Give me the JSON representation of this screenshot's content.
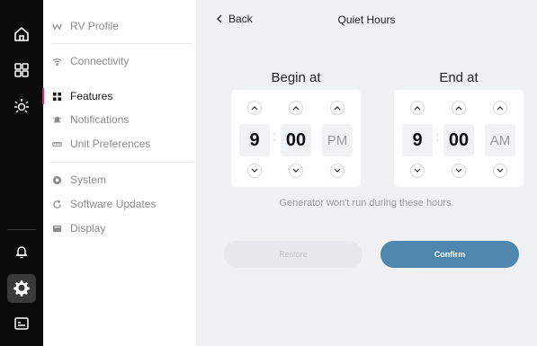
{
  "rail": {
    "items": [
      {
        "icon": "home-icon"
      },
      {
        "icon": "grid-icon"
      },
      {
        "icon": "brightness-icon"
      },
      {
        "icon": "bell-icon"
      },
      {
        "icon": "gear-icon"
      },
      {
        "icon": "device-icon"
      }
    ],
    "active": "gear-icon"
  },
  "menu": {
    "items": [
      {
        "label": "RV Profile",
        "icon": "rv-icon"
      },
      {
        "label": "Connectivity",
        "icon": "wifi-icon"
      },
      {
        "label": "Features",
        "icon": "features-icon"
      },
      {
        "label": "Notifications",
        "icon": "notification-icon"
      },
      {
        "label": "Unit Preferences",
        "icon": "ruler-icon"
      },
      {
        "label": "System",
        "icon": "system-icon"
      },
      {
        "label": "Software Updates",
        "icon": "refresh-icon"
      },
      {
        "label": "Display",
        "icon": "display-icon"
      }
    ],
    "active": "Features"
  },
  "header": {
    "back_label": "Back",
    "title": "Quiet Hours"
  },
  "begin": {
    "label": "Begin at",
    "hour": "9",
    "minute": "00",
    "period": "PM"
  },
  "end": {
    "label": "End at",
    "hour": "9",
    "minute": "00",
    "period": "AM"
  },
  "colon": ":",
  "hint": "Generator won't run during these hours.",
  "buttons": {
    "restore": "Restore",
    "confirm": "Confirm"
  },
  "colors": {
    "accent": "#4f86ad",
    "active_marker": "#e0245e",
    "rail_bg": "#0b0b0b",
    "panel_bg": "#f0f1f3"
  }
}
